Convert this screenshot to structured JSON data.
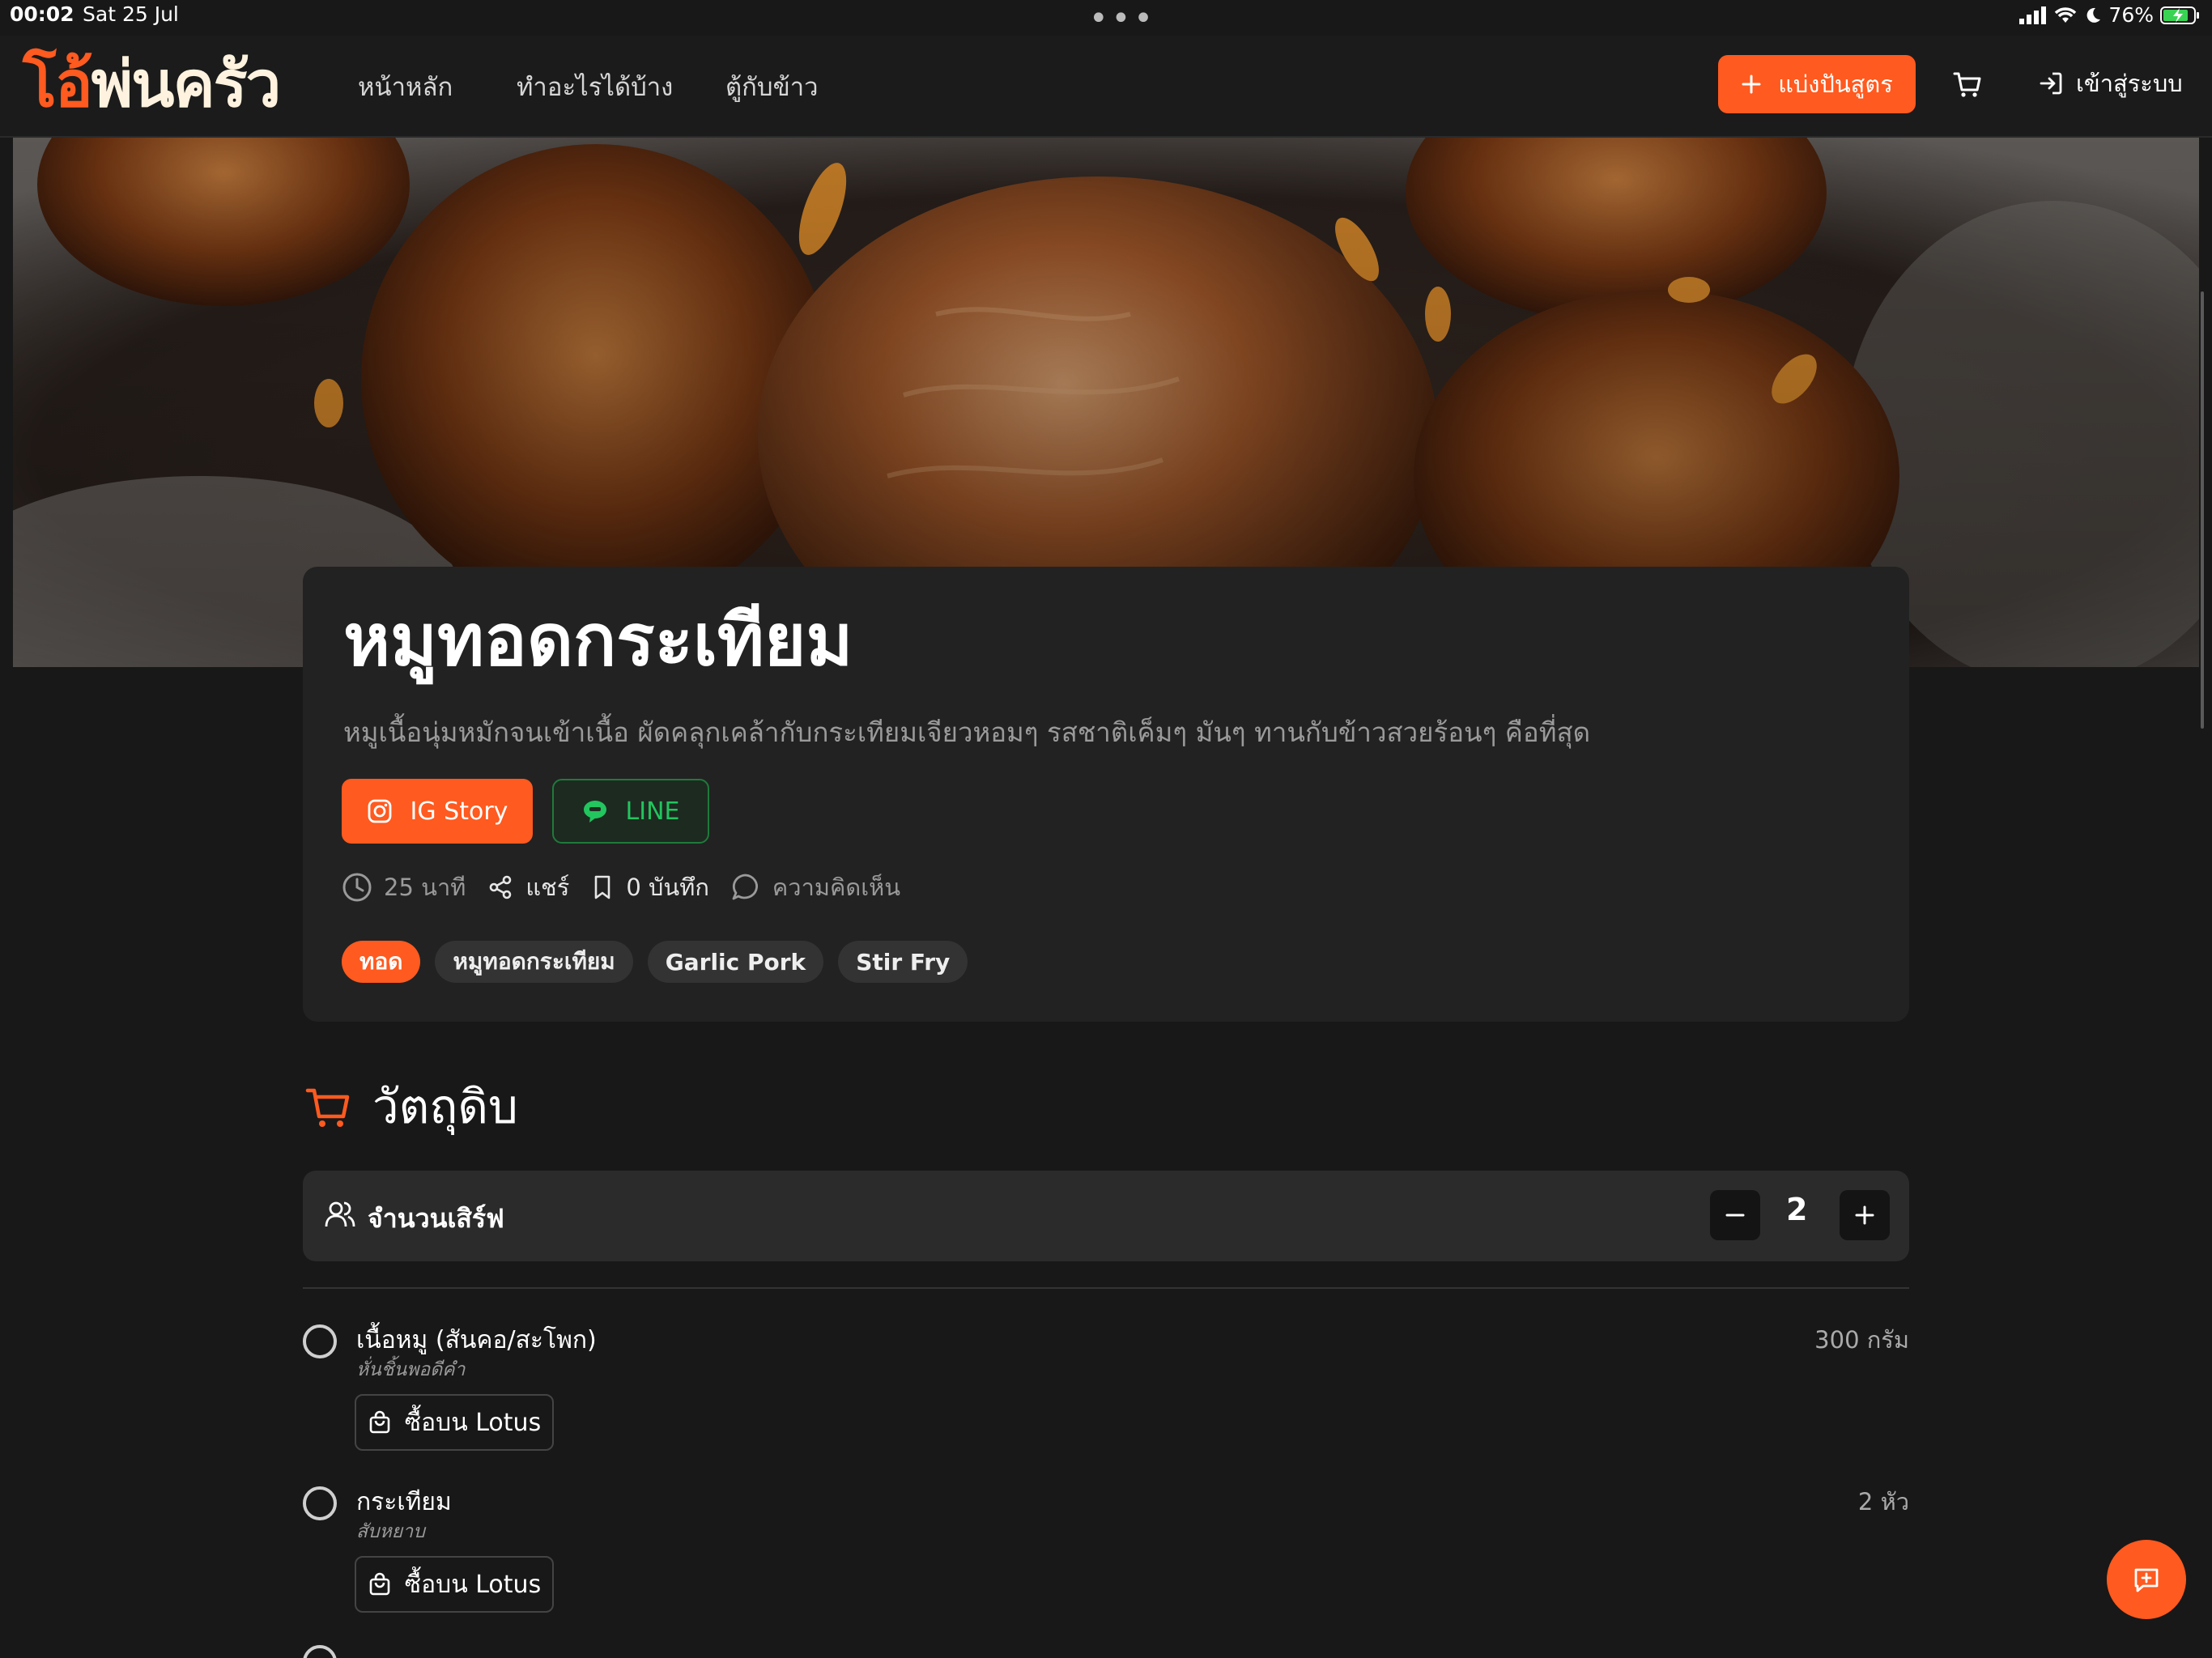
{
  "status_bar": {
    "time": "00:02",
    "date": "Sat 25 Jul",
    "battery": "76%"
  },
  "nav": {
    "logo_part1": "โอ้",
    "logo_part2": "พ่นครัว",
    "links": [
      "หน้าหลัก",
      "ทำอะไรได้บ้าง",
      "ตู้กับข้าว"
    ],
    "share_label": "แบ่งปันสูตร",
    "login_label": "เข้าสู่ระบบ"
  },
  "recipe": {
    "title": "หมูทอดกระเทียม",
    "description": "หมูเนื้อนุ่มหมักจนเข้าเนื้อ ผัดคลุกเคล้ากับกระเทียมเจียวหอมๆ รสชาติเค็มๆ มันๆ ทานกับข้าวสวยร้อนๆ คือที่สุด",
    "ig_label": "IG Story",
    "line_label": "LINE",
    "time": "25 นาที",
    "share": "แชร์",
    "saves": "0 บันทึก",
    "comments": "ความคิดเห็น",
    "tags": [
      "ทอด",
      "หมูทอดกระเทียม",
      "Garlic Pork",
      "Stir Fry"
    ]
  },
  "ingredients": {
    "heading": "วัตถุดิบ",
    "servings_label": "จำนวนเสิร์ฟ",
    "servings": "2",
    "buy_label": "ซื้อบน Lotus",
    "items": [
      {
        "name": "เนื้อหมู (สันคอ/สะโพก)",
        "note": "หั่นชิ้นพอดีคำ",
        "amount": "300 กรัม"
      },
      {
        "name": "กระเทียม",
        "note": "สับหยาบ",
        "amount": "2 หัว"
      }
    ]
  },
  "colors": {
    "accent": "#ff5a1f",
    "line_green": "#22c55e",
    "background": "#181818",
    "card": "#222222"
  }
}
